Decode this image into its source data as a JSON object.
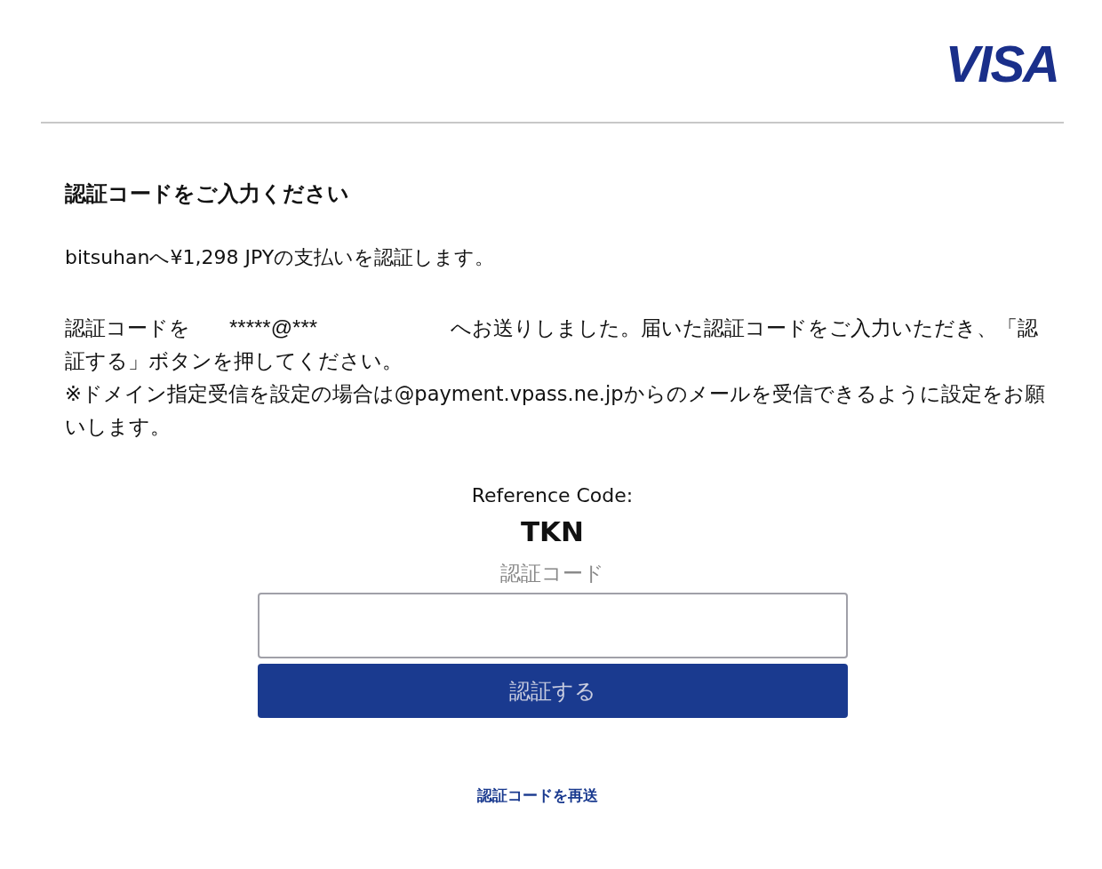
{
  "header": {
    "logo": "VISA"
  },
  "title": "認証コードをご入力ください",
  "amount_line": "bitsuhanへ¥1,298 JPYの支払いを認証します。",
  "message": {
    "before": "認証コードを",
    "email": "*****@***",
    "after": "へお送りしました。届いた認証コードをご入力いただき、「認証する」ボタンを押してください。"
  },
  "note": "※ドメイン指定受信を設定の場合は@payment.vpass.ne.jpからのメールを受信できるように設定をお願いします。",
  "reference": {
    "label": "Reference Code:",
    "value": "TKN"
  },
  "code_field": {
    "label": "認証コード"
  },
  "submit_button": "認証する",
  "resend_link": "認証コードを再送"
}
